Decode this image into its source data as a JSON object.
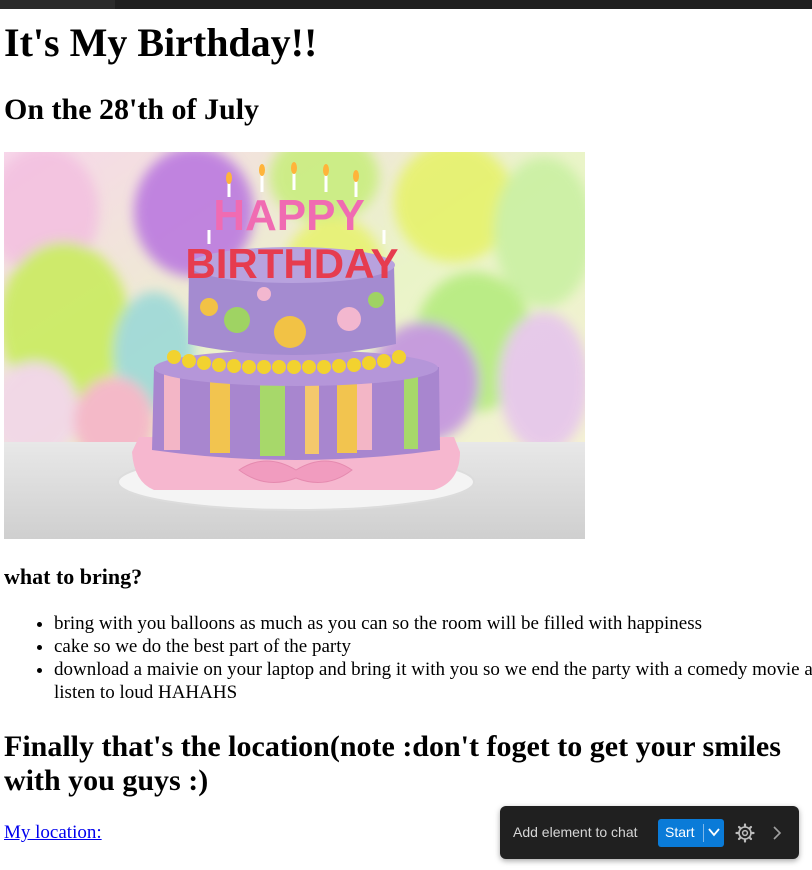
{
  "page": {
    "title": "It's My Birthday!!",
    "date_heading": "On the 28'th of July",
    "image": {
      "alt": "Happy birthday cake",
      "cake_text_line1": "HAPPY",
      "cake_text_line2": "BIRTHDAY"
    },
    "bring_heading": "what to bring?",
    "bring_items": [
      "bring with you balloons as much as you can so the room will be filled with happiness",
      "cake so we do the best part of the party",
      "download a maivie on your laptop and bring it with you so we end the party with a comedy movie and listen to loud HAHAHS"
    ],
    "location_heading": "Finally that's the location(note :don't foget to get your smiles with you guys :)",
    "location_link": "My location:"
  },
  "chat_toolbar": {
    "label": "Add element to chat",
    "start_label": "Start",
    "icons": [
      "chevron-down-icon",
      "gear-icon",
      "chevron-right-icon"
    ]
  },
  "colors": {
    "link": "#0000ee",
    "toolbar_bg": "#202020",
    "start_button": "#0a7bd8"
  }
}
